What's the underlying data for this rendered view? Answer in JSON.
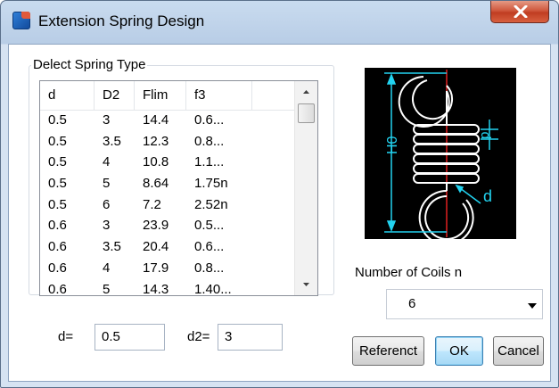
{
  "window": {
    "title": "Extension Spring Design",
    "close_label": "X"
  },
  "group": {
    "label": "Delect Spring Type"
  },
  "table": {
    "columns": [
      "d",
      "D2",
      "Flim",
      "f3"
    ],
    "rows": [
      [
        "0.5",
        "3",
        "14.4",
        "0.6..."
      ],
      [
        "0.5",
        "3.5",
        "12.3",
        "0.8..."
      ],
      [
        "0.5",
        "4",
        "10.8",
        "1.1..."
      ],
      [
        "0.5",
        "5",
        "8.64",
        "1.75n"
      ],
      [
        "0.5",
        "6",
        "7.2",
        "2.52n"
      ],
      [
        "0.6",
        "3",
        "23.9",
        "0.5..."
      ],
      [
        "0.6",
        "3.5",
        "20.4",
        "0.6..."
      ],
      [
        "0.6",
        "4",
        "17.9",
        "0.8..."
      ],
      [
        "0.6",
        "5",
        "14.3",
        "1.40..."
      ]
    ]
  },
  "fields": {
    "d_label": "d=",
    "d_value": "0.5",
    "d2_label": "d2=",
    "d2_value": "3"
  },
  "diagram": {
    "label_H0": "H0",
    "label_p": "p",
    "label_d": "d"
  },
  "coils": {
    "label": "Number of Coils n",
    "value": "6"
  },
  "buttons": {
    "reference": "Referenct",
    "ok": "OK",
    "cancel": "Cancel"
  },
  "colors": {
    "diagram_background": "#000000",
    "spring_stroke": "#ffffff",
    "dimension_lines": "#22d3f0",
    "center_line": "#e02020"
  },
  "icons": {
    "app": "app-logo-icon",
    "close": "close-icon",
    "scroll_up": "scroll-up-arrow-icon",
    "scroll_down": "scroll-down-arrow-icon",
    "dropdown": "chevron-down-icon"
  }
}
